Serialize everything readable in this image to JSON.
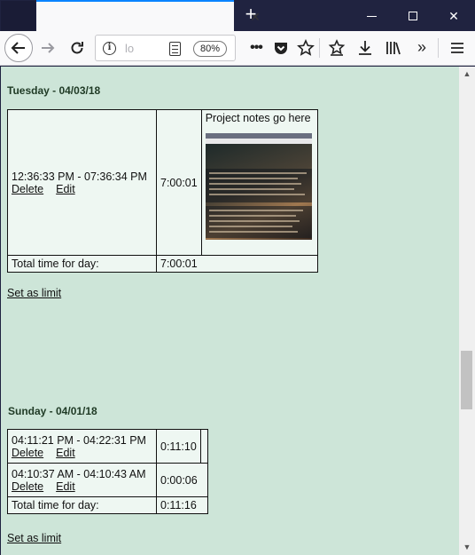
{
  "browser": {
    "url_text": "lo",
    "zoom": "80%",
    "icons": [
      "back-icon",
      "forward-icon",
      "reload-icon",
      "info-icon",
      "reader-view-icon",
      "more-icon",
      "pocket-icon",
      "bookmark-star-icon",
      "bookmarks-toolbar-icon",
      "download-icon",
      "library-icon",
      "overflow-icon",
      "menu-icon"
    ]
  },
  "days": [
    {
      "heading": "Tuesday - 04/03/18",
      "entries": [
        {
          "range": "12:36:33 PM - 07:36:34 PM",
          "duration": "7:00:01",
          "delete": "Delete",
          "edit": "Edit"
        }
      ],
      "notes": "Project notes go here",
      "total_label": "Total time for day:",
      "total_value": "7:00:01",
      "limit_link": "Set as limit"
    },
    {
      "heading": "Sunday - 04/01/18",
      "entries": [
        {
          "range": "04:11:21 PM - 04:22:31 PM",
          "duration": "0:11:10",
          "delete": "Delete",
          "edit": "Edit"
        },
        {
          "range": "04:10:37 AM - 04:10:43 AM",
          "duration": "0:00:06",
          "delete": "Delete",
          "edit": "Edit"
        }
      ],
      "total_label": "Total time for day:",
      "total_value": "0:11:16",
      "limit_link": "Set as limit"
    }
  ],
  "colors": {
    "page_bg": "#cde5d8",
    "cell_bg": "#eef7f2",
    "tabstrip": "#202340"
  }
}
